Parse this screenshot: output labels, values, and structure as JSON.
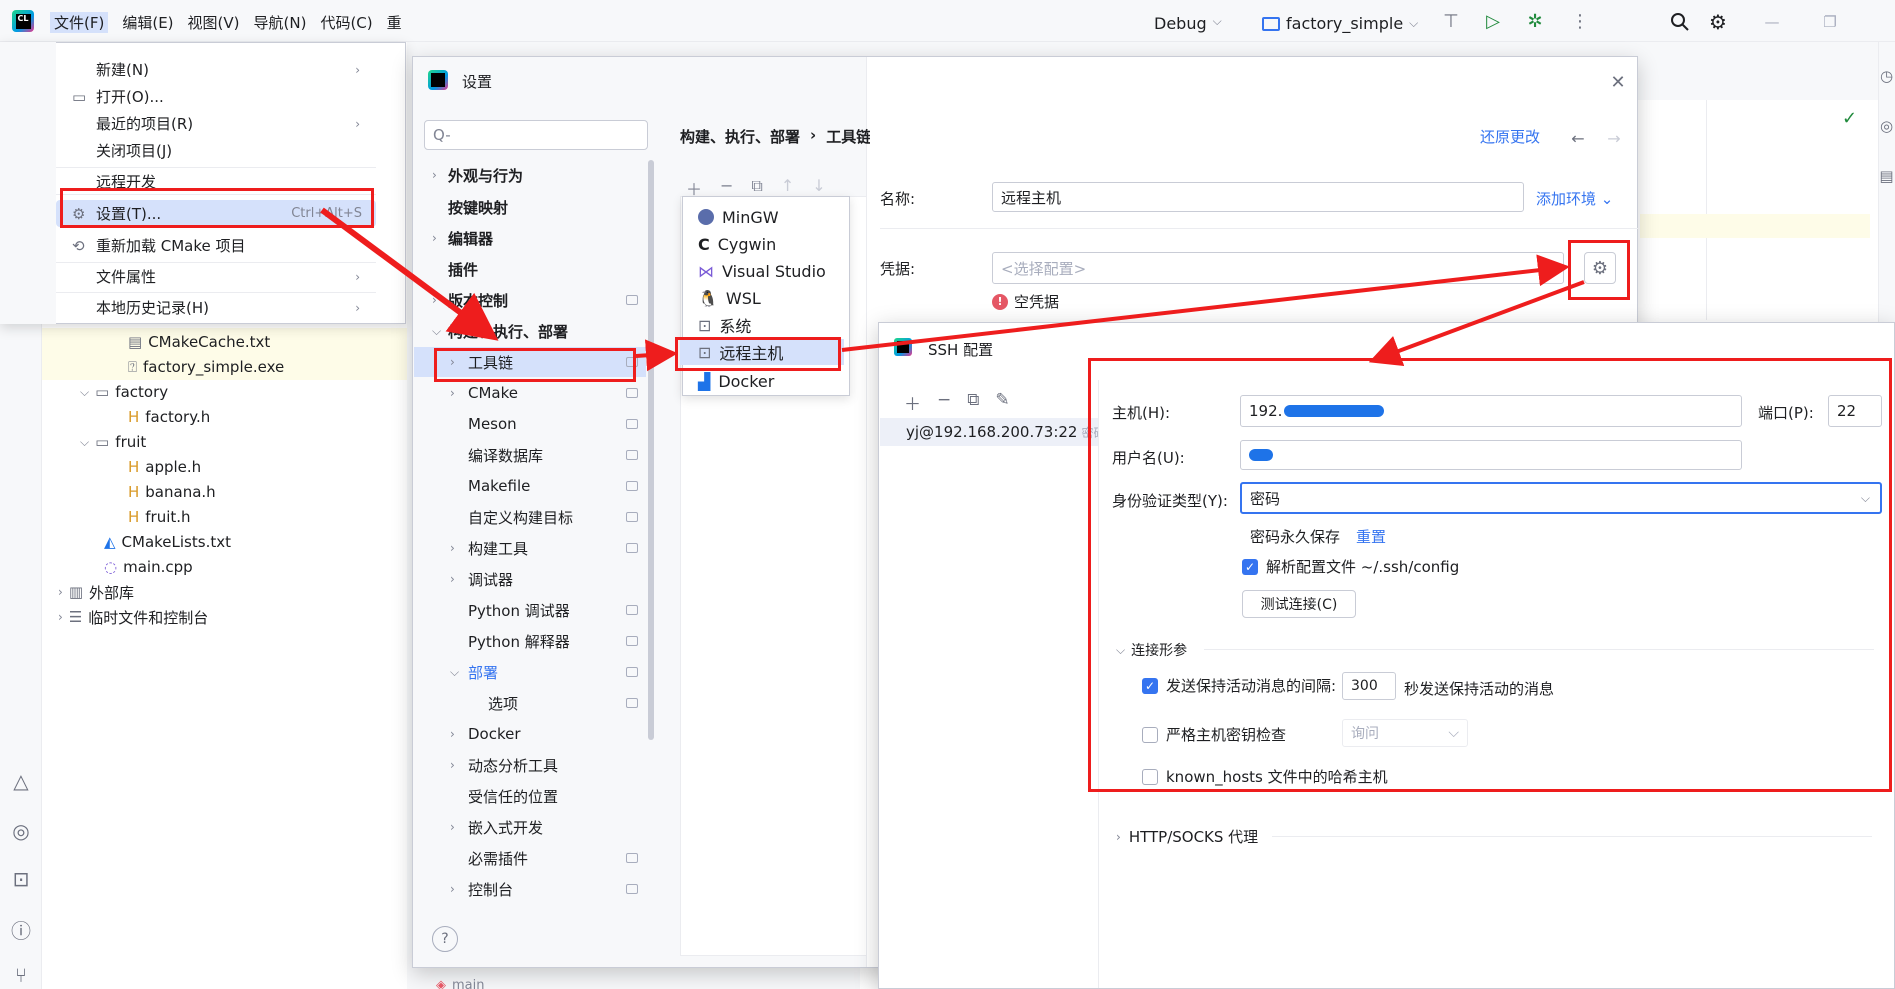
{
  "titlebar": {
    "menus": [
      "文件(F)",
      "编辑(E)",
      "视图(V)",
      "导航(N)",
      "代码(C)",
      "重"
    ],
    "run_config": "Debug",
    "project": "factory_simple"
  },
  "file_menu": {
    "items": [
      {
        "label": "新建(N)",
        "shortcut": ""
      },
      {
        "label": "打开(O)...",
        "shortcut": ""
      },
      {
        "label": "最近的项目(R)",
        "shortcut": ""
      },
      {
        "label": "关闭项目(J)",
        "shortcut": ""
      },
      {
        "label": "远程开发",
        "shortcut": ""
      },
      {
        "label": "设置(T)...",
        "shortcut": "Ctrl+Alt+S"
      },
      {
        "label": "重新加载 CMake 项目",
        "shortcut": ""
      },
      {
        "label": "文件属性",
        "shortcut": ""
      },
      {
        "label": "本地历史记录(H)",
        "shortcut": ""
      }
    ]
  },
  "project_tree": {
    "items": [
      "CMakeCache.txt",
      "factory_simple.exe",
      "factory",
      "factory.h",
      "fruit",
      "apple.h",
      "banana.h",
      "fruit.h",
      "CMakeLists.txt",
      "main.cpp",
      "外部库",
      "临时文件和控制台"
    ],
    "bottom_tab": "main"
  },
  "settings": {
    "title": "设置",
    "search_placeholder": "Q-",
    "tree": [
      "外观与行为",
      "按键映射",
      "编辑器",
      "插件",
      "版本控制",
      "构建、执行、部署",
      "工具链",
      "CMake",
      "Meson",
      "编译数据库",
      "Makefile",
      "自定义构建目标",
      "构建工具",
      "调试器",
      "Python 调试器",
      "Python 解释器",
      "部署",
      "选项",
      "Docker",
      "动态分析工具",
      "受信任的位置",
      "嵌入式开发",
      "必需插件",
      "控制台"
    ],
    "breadcrumb": [
      "构建、执行、部署",
      "›",
      "工具链"
    ],
    "toolchain_types": [
      "MinGW",
      "Cygwin",
      "Visual Studio",
      "WSL",
      "系统",
      "远程主机",
      "Docker"
    ],
    "reset_link": "还原更改",
    "name_label": "名称:",
    "name_value": "远程主机",
    "add_env": "添加环境 ⌄",
    "credentials_label": "凭据:",
    "credentials_placeholder": "<选择配置>",
    "credentials_error": "空凭据"
  },
  "ssh": {
    "title": "SSH 配置",
    "entry": "yj@192.168.200.73:22",
    "entry_suffix": "密码",
    "host_label": "主机(H):",
    "host_value": "192.",
    "port_label": "端口(P):",
    "port_value": "22",
    "user_label": "用户名(U):",
    "auth_label": "身份验证类型(Y):",
    "auth_value": "密码",
    "save_password": "密码永久保存",
    "reset": "重置",
    "parse_config": "解析配置文件 ~/.ssh/config",
    "test_connection": "测试连接(C)",
    "conn_params": "连接形参",
    "keepalive_label": "发送保持活动消息的间隔:",
    "keepalive_value": "300",
    "keepalive_suffix": "秒发送保持活动的消息",
    "strict_label": "严格主机密钥检查",
    "strict_value": "询问",
    "hash_label": "known_hosts 文件中的哈希主机",
    "proxy": "HTTP/SOCKS 代理"
  },
  "colors": {
    "accent": "#3574f0",
    "annotation": "#ee1d1d",
    "error": "#e55765",
    "scribble": "#1e73e8"
  }
}
